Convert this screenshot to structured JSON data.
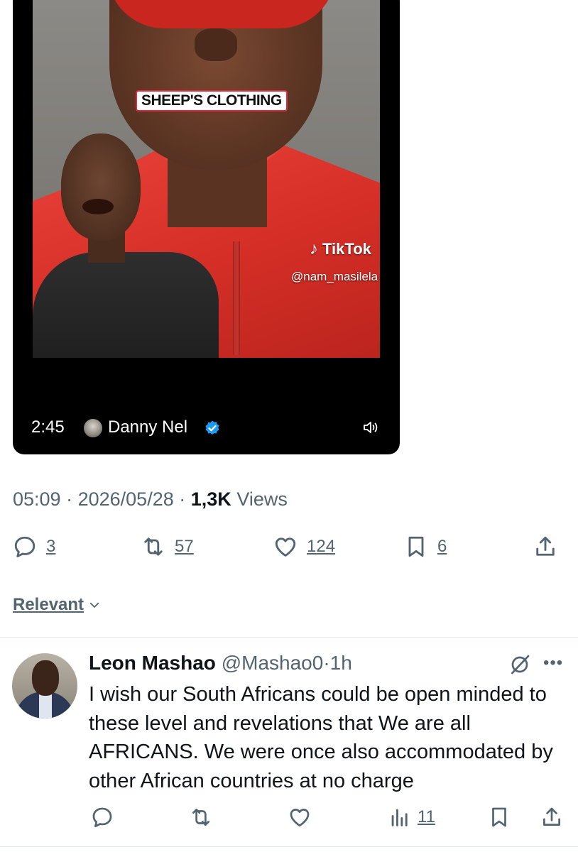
{
  "video": {
    "caption_overlay": "SHEEP'S CLOTHING",
    "watermark_brand": "TikTok",
    "watermark_handle": "@nam_masilela",
    "duration": "2:45",
    "channel_name": "Danny Nel",
    "verified": true,
    "volume_icon": "speaker-icon"
  },
  "tweet": {
    "time": "05:09",
    "date": "2026/05/28",
    "views_count": "1,3K",
    "views_label": "Views",
    "actions": {
      "replies": "3",
      "reposts": "57",
      "likes": "124",
      "bookmarks": "6"
    }
  },
  "sort": {
    "label": "Relevant"
  },
  "reply": {
    "name": "Leon Mashao",
    "handle": "@Mashao0",
    "time": "1h",
    "text": "I wish our South Africans could be open minded to these level and revelations that We are all AFRICANS. We were once also accommodated by other African countries at no charge",
    "views": "11"
  },
  "colors": {
    "text_primary": "#0f1419",
    "text_secondary": "#536471",
    "verified_blue": "#1d9bf0",
    "divider": "#e1e6ea"
  }
}
